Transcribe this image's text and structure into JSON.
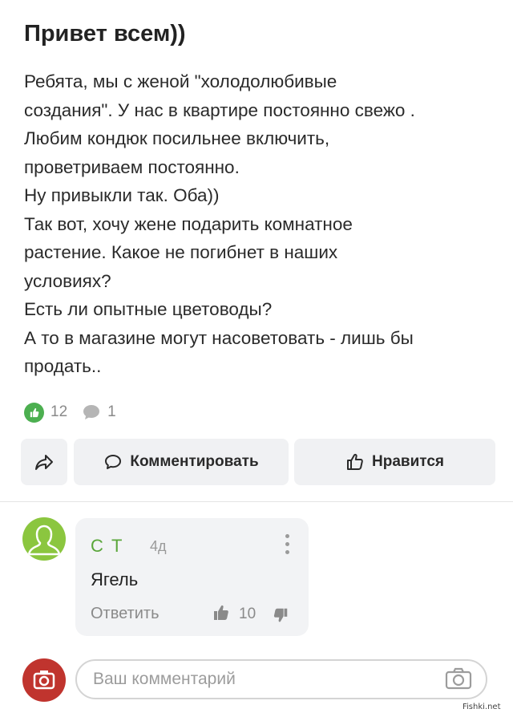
{
  "post": {
    "title": "Привет всем))",
    "lines": [
      "Ребята, мы с женой \"холодолюбивые",
      "создания\". У нас в квартире постоянно свежо .",
      "Любим кондюк посильнее включить,",
      "проветриваем постоянно.",
      "Ну привыкли так. Оба))",
      "Так вот, хочу жене подарить комнатное",
      "растение. Какое не погибнет в наших",
      "условиях?",
      "Есть ли опытные цветоводы?",
      "А то в магазине могут насоветовать - лишь бы",
      "продать.."
    ],
    "likes_count": "12",
    "comments_count": "1"
  },
  "actions": {
    "comment_label": "Комментировать",
    "like_label": "Нравится"
  },
  "comment": {
    "author": "С Т",
    "age": "4д",
    "text": "Ягель",
    "reply_label": "Ответить",
    "votes": "10"
  },
  "composer": {
    "placeholder": "Ваш комментарий"
  },
  "watermark": "Fishki.net",
  "colors": {
    "like_green": "#4caf50",
    "author_green": "#5aa63a",
    "avatar_green": "#8bc63f",
    "avatar_red": "#c0342e"
  }
}
